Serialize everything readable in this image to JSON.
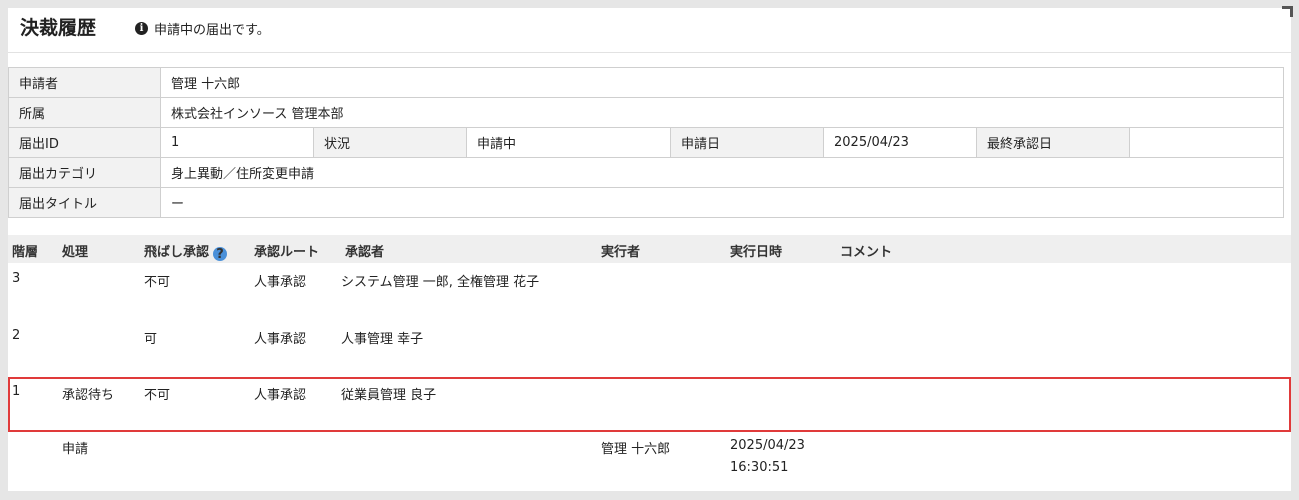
{
  "header": {
    "title": "決裁履歴",
    "notice": "申請中の届出です。",
    "info_icon": "i"
  },
  "info": {
    "applicant_label": "申請者",
    "applicant": "管理 十六郎",
    "affiliation_label": "所属",
    "affiliation": "株式会社インソース 管理本部",
    "id_label": "届出ID",
    "id": "1",
    "status_label": "状況",
    "status": "申請中",
    "apply_date_label": "申請日",
    "apply_date": "2025/04/23",
    "final_date_label": "最終承認日",
    "final_date": "",
    "category_label": "届出カテゴリ",
    "category": "身上異動／住所変更申請",
    "doc_title_label": "届出タイトル",
    "doc_title": "ー"
  },
  "approvals": {
    "columns": {
      "level": "階層",
      "process": "処理",
      "skip": "飛ばし承認",
      "route": "承認ルート",
      "approver": "承認者",
      "executor": "実行者",
      "datetime": "実行日時",
      "comment": "コメント"
    },
    "help_icon": "?",
    "rows": [
      {
        "level": "3",
        "process": "",
        "skip": "不可",
        "route": "人事承認",
        "approver": "システム管理 一郎, 全権管理 花子",
        "executor": "",
        "date": "",
        "time": "",
        "comment": ""
      },
      {
        "level": "2",
        "process": "",
        "skip": "可",
        "route": "人事承認",
        "approver": "人事管理 幸子",
        "executor": "",
        "date": "",
        "time": "",
        "comment": ""
      },
      {
        "level": "1",
        "process": "承認待ち",
        "skip": "不可",
        "route": "人事承認",
        "approver": "従業員管理 良子",
        "executor": "",
        "date": "",
        "time": "",
        "comment": ""
      },
      {
        "level": "",
        "process": "申請",
        "skip": "",
        "route": "",
        "approver": "",
        "executor": "管理 十六郎",
        "date": "2025/04/23",
        "time": "16:30:51",
        "comment": ""
      }
    ]
  },
  "colors": {
    "highlight_border": "#e03a3a",
    "help_icon": "#4a90d9"
  }
}
